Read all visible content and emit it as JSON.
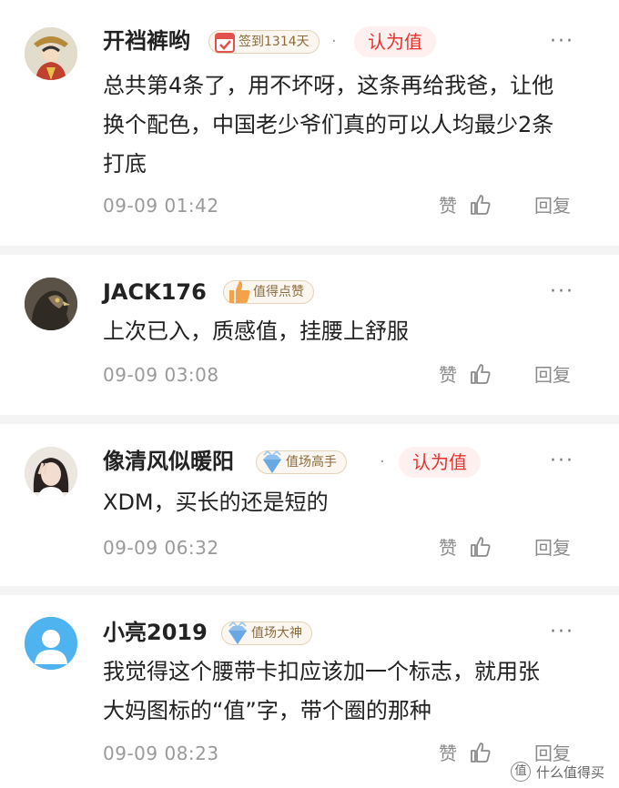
{
  "comments": [
    {
      "username": "开裆裤哟",
      "badge": "签到1314天",
      "badge_icon": "calendar-check-icon",
      "dot": "·",
      "approve": "认为值",
      "text_lines": [
        "总共第4条了，用不坏呀，这条再给我爸，让他",
        "换个配色，中国老少爷们真的可以人均最少2条",
        "打底"
      ],
      "time": "09-09 01:42",
      "like_label": "赞",
      "reply_label": "回复",
      "more": "···"
    },
    {
      "username": "JACK176",
      "badge": "值得点赞",
      "badge_icon": "thumbs-up-icon",
      "text_lines": [
        "上次已入，质感值，挂腰上舒服"
      ],
      "time": "09-09 03:08",
      "like_label": "赞",
      "reply_label": "回复",
      "more": "···"
    },
    {
      "username": "像清风似暖阳",
      "badge": "值场高手",
      "badge_icon": "diamond-icon",
      "dot": "·",
      "approve": "认为值",
      "text_lines": [
        "XDM，买长的还是短的"
      ],
      "time": "09-09 06:32",
      "like_label": "赞",
      "reply_label": "回复",
      "more": "···"
    },
    {
      "username": "小亮2019",
      "badge": "值场大神",
      "badge_icon": "diamond-icon",
      "text_lines": [
        "我觉得这个腰带卡扣应该加一个标志，就用张",
        "大妈图标的“值”字，带个圈的那种"
      ],
      "time": "09-09 08:23",
      "like_label": "赞",
      "reply_label": "回复",
      "more": "···"
    }
  ],
  "watermark": {
    "logo_char": "值",
    "text": "什么值得买"
  },
  "colors": {
    "approve_red": "#e5322d",
    "badge_gold": "#8b6b3e",
    "meta_gray": "#9a9a9a",
    "avatar_blue": "#4fb3f0"
  }
}
